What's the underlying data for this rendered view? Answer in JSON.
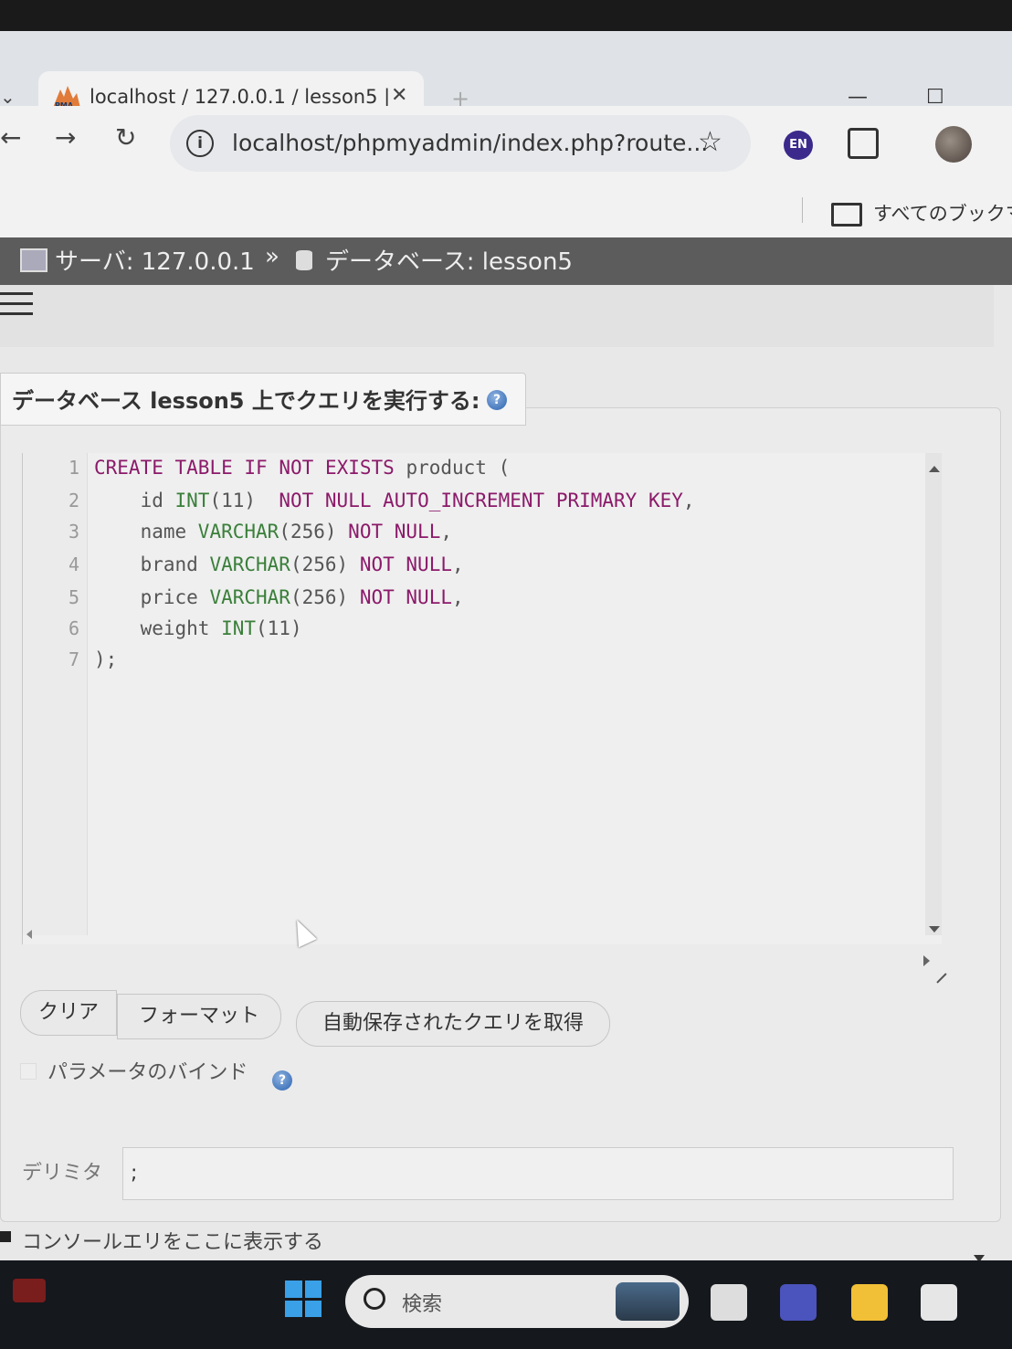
{
  "browser": {
    "tab_title": "localhost / 127.0.0.1 / lesson5 |",
    "tab_close": "✕",
    "new_tab": "+",
    "url": "localhost/phpmyadmin/index.php?route...",
    "profile_badge": "EN",
    "bookmarks_label": "すべてのブックマー",
    "minimize": "—",
    "maximize": "☐"
  },
  "breadcrumb": {
    "server": "サーバ: 127.0.0.1",
    "separator": "»",
    "database": "データベース: lesson5"
  },
  "query_panel": {
    "title": "データベース lesson5 上でクエリを実行する:",
    "help_glyph": "?"
  },
  "editor": {
    "line_numbers": [
      "1",
      "2",
      "3",
      "4",
      "5",
      "6",
      "7"
    ],
    "lines": [
      "CREATE TABLE IF NOT EXISTS product (",
      "    id INT(11)  NOT NULL AUTO_INCREMENT PRIMARY KEY,",
      "    name VARCHAR(256) NOT NULL,",
      "    brand VARCHAR(256) NOT NULL,",
      "    price VARCHAR(256) NOT NULL,",
      "    weight INT(11)",
      ");"
    ]
  },
  "buttons": {
    "clear": "クリア",
    "format": "フォーマット",
    "get_autosaved": "自動保存されたクエリを取得"
  },
  "bind_parameters": {
    "label": "パラメータのバインド"
  },
  "delimiter": {
    "label": "デリミタ",
    "value": ";"
  },
  "console": {
    "text": "コンソールエリをここに表示する"
  },
  "taskbar": {
    "search_placeholder": "検索"
  },
  "colors": {
    "pma_bar": "#5c5c5c",
    "keyword": "#8b1a6a",
    "type": "#3a7f3a",
    "profile_badge": "#3b2a8c"
  }
}
